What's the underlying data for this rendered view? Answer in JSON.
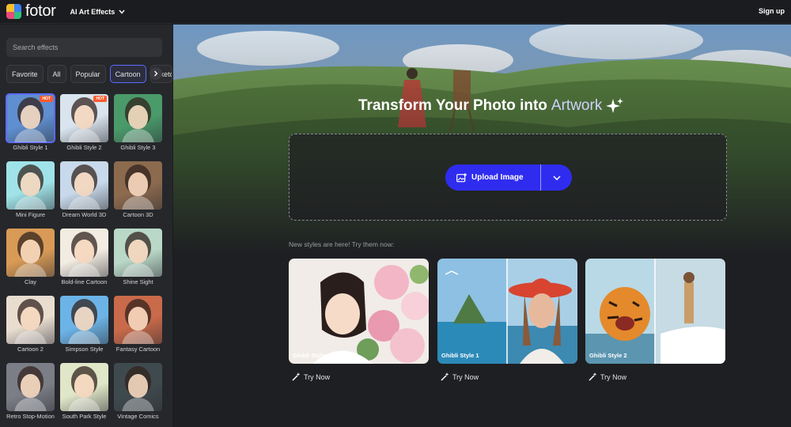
{
  "header": {
    "logo_text": "fotor",
    "nav_label": "AI Art Effects",
    "signup_label": "Sign up"
  },
  "sidebar": {
    "search_placeholder": "Search effects",
    "chips": [
      "Favorite",
      "All",
      "Popular",
      "Cartoon",
      "Sketch"
    ],
    "active_chip": "Cartoon",
    "effects": [
      {
        "label": "Ghibli Style 1",
        "hot": "HOT",
        "bg": "#5f8fd0"
      },
      {
        "label": "Ghibli Style 2",
        "hot": "HOT",
        "bg": "#d9e4ee"
      },
      {
        "label": "Ghibli Style 3",
        "hot": "",
        "bg": "#4a9a6a"
      },
      {
        "label": "Mini Figure",
        "hot": "",
        "bg": "#9fe3e8"
      },
      {
        "label": "Dream World 3D",
        "hot": "",
        "bg": "#c7d9ea"
      },
      {
        "label": "Cartoon 3D",
        "hot": "",
        "bg": "#8c6a4e"
      },
      {
        "label": "Clay",
        "hot": "",
        "bg": "#d89a56"
      },
      {
        "label": "Bold-line Cartoon",
        "hot": "",
        "bg": "#f2ece2"
      },
      {
        "label": "Shine Sight",
        "hot": "",
        "bg": "#b9d8c8"
      },
      {
        "label": "Cartoon 2",
        "hot": "",
        "bg": "#e9ddd0"
      },
      {
        "label": "Simpson Style",
        "hot": "",
        "bg": "#6cb4e8"
      },
      {
        "label": "Fantasy Cartoon",
        "hot": "",
        "bg": "#c96a4a"
      },
      {
        "label": "Retro Stop-Motion",
        "hot": "",
        "bg": "#7b7e86"
      },
      {
        "label": "South Park Style",
        "hot": "",
        "bg": "#e0e6c8"
      },
      {
        "label": "Vintage Comics",
        "hot": "",
        "bg": "#3f4a4e"
      }
    ]
  },
  "main": {
    "hero_title": "Transform Your Photo into",
    "hero_accent": "Artwork",
    "upload_label": "Upload Image",
    "new_styles_text": "New styles are here! Try them now:",
    "features": [
      {
        "label": "Ghibli Style 1",
        "try_label": "Try Now"
      },
      {
        "label": "Ghibli Style 1",
        "try_label": "Try Now"
      },
      {
        "label": "Ghibli Style 2",
        "try_label": "Try Now"
      }
    ]
  },
  "colors": {
    "accent": "#2f2cf0",
    "hot_badge": "#ff5a2e",
    "selection": "#5b6cff"
  }
}
